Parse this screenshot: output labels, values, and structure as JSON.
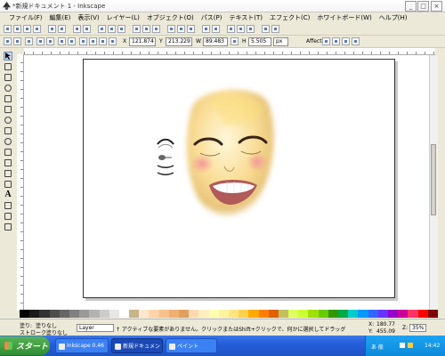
{
  "window": {
    "title": "*新規ドキュメント 1 - Inkscape",
    "controls": [
      "_",
      "□",
      "×"
    ]
  },
  "menubar": {
    "items": [
      "ファイル(F)",
      "編集(E)",
      "表示(V)",
      "レイヤー(L)",
      "オブジェクト(O)",
      "パス(P)",
      "テキスト(T)",
      "エフェクト(C)",
      "ホワイトボード(W)",
      "ヘルプ(H)"
    ]
  },
  "controls_bar": {
    "x_label": "X",
    "x_value": "121.874",
    "y_label": "Y",
    "y_value": "213.229",
    "w_label": "W",
    "w_value": "89.483",
    "h_label": "H",
    "h_value": "5.505",
    "unit": "px",
    "affect_label": "Affect:"
  },
  "statusbar": {
    "fill_label": "塗り:",
    "fill_value": "塗りなし",
    "stroke_label": "ストローク:",
    "stroke_value": "塗りなし",
    "layer_value": "Layer",
    "message": "↑ アクティブな要素がありません。クリックまたはShift+クリックで、何かに選択してドラッグして使用してください。",
    "x_label": "X:",
    "x_value": "180.77",
    "y_label": "Y:",
    "y_value": "455.09",
    "zoom_label": "Z:",
    "zoom_value": "35%"
  },
  "taskbar": {
    "start_label": "スタート",
    "tasks": [
      "Inkscape 0.46",
      "新規ドキュメント…",
      "ペイント"
    ],
    "tray_ime": "あ 般",
    "clock": "14:42"
  },
  "colors": {
    "titlebar": "#f4f4f4",
    "window_bg": "#ece9d8",
    "taskbar": "#245edb",
    "start": "#2f8d2f"
  },
  "palette_colors": [
    "#000000",
    "#1a1a1a",
    "#333333",
    "#4d4d4d",
    "#666666",
    "#808080",
    "#999999",
    "#b3b3b3",
    "#cccccc",
    "#e6e6e6",
    "#ffffff",
    "#c8b48c",
    "#ffe6cc",
    "#ffd5a8",
    "#f5c28a",
    "#f0b070",
    "#e0a060",
    "#ffd9b0",
    "#fff0c0",
    "#ffffb0",
    "#fff3a0",
    "#ffe680",
    "#ffd24d",
    "#ffaa00",
    "#ff8000",
    "#e06000",
    "#c0c060",
    "#e0ff60",
    "#ccff33",
    "#a0e000",
    "#66cc00",
    "#339900",
    "#00aa44",
    "#00cccc",
    "#0099ff",
    "#3366ff",
    "#6633ff",
    "#9900cc",
    "#cc0099",
    "#ff3366",
    "#ff0000",
    "#800000"
  ]
}
